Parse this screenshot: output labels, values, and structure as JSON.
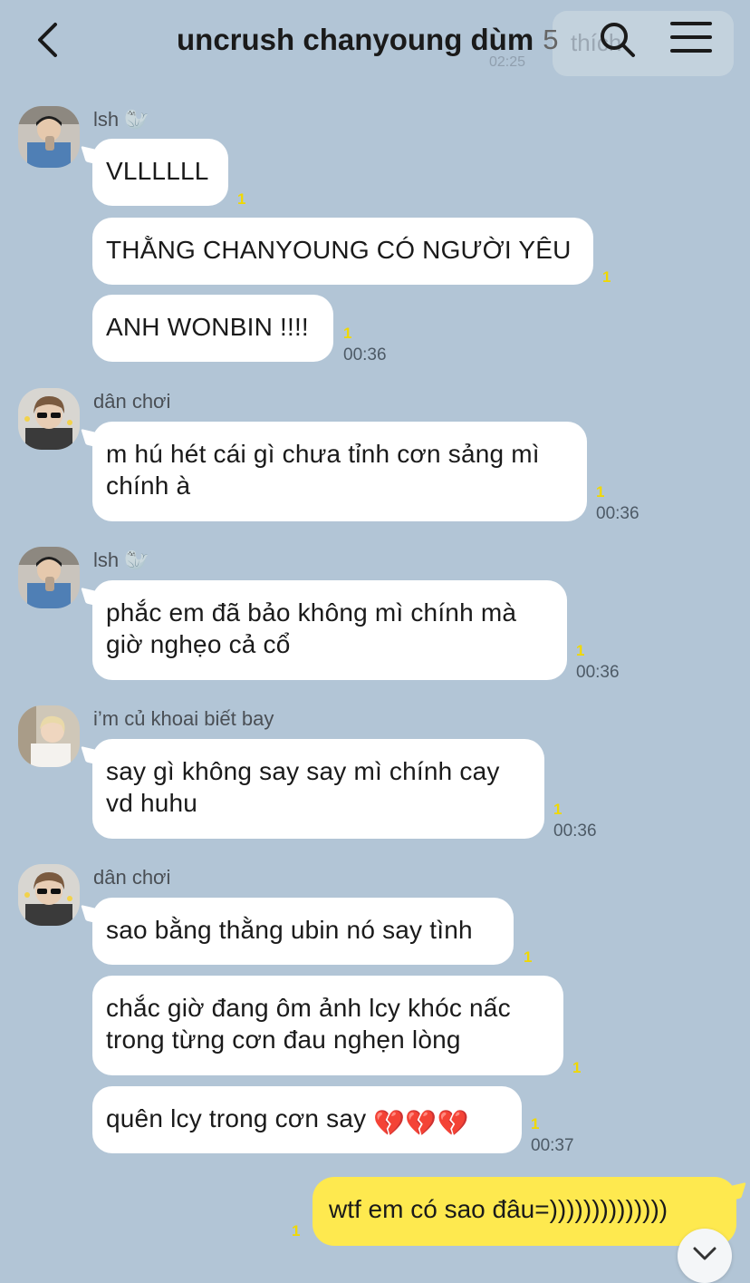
{
  "header": {
    "title": "uncrush chanyoung dùm",
    "member_count": "5",
    "ghost_text": "thích",
    "ghost_time": "02:25",
    "icons": {
      "back": "chevron-left-icon",
      "search": "search-icon",
      "menu": "menu-icon"
    }
  },
  "colors": {
    "background": "#b2c5d6",
    "my_bubble": "#fee94f",
    "unread": "#f0d800"
  },
  "messages": [
    {
      "sender": "lsh 🦭",
      "text": "VLLLLLL",
      "unread": "1",
      "time": ""
    },
    {
      "text": "THẰNG CHANYOUNG CÓ NGƯỜI YÊU",
      "unread": "1",
      "time": ""
    },
    {
      "text": "ANH WONBIN !!!!",
      "unread": "1",
      "time": "00:36"
    },
    {
      "sender": "dân chơi",
      "text": "m hú hét cái gì chưa tỉnh cơn sảng mì chính à",
      "unread": "1",
      "time": "00:36"
    },
    {
      "sender": "lsh 🦭",
      "text": "phắc em đã bảo không mì chính mà giờ nghẹo cả cổ",
      "unread": "1",
      "time": "00:36"
    },
    {
      "sender": "i’m củ khoai biết bay",
      "text": "say gì không say say mì chính cay vd huhu",
      "unread": "1",
      "time": "00:36"
    },
    {
      "sender": "dân chơi",
      "text": "sao bằng thằng ubin nó say tình",
      "unread": "1",
      "time": ""
    },
    {
      "text": "chắc giờ đang ôm ảnh lcy khóc nấc trong từng cơn đau nghẹn lòng",
      "unread": "1",
      "time": ""
    },
    {
      "text": "quên lcy trong cơn say",
      "emoji": "💔💔💔",
      "unread": "1",
      "time": "00:37"
    },
    {
      "text": "wtf em có sao đâu=))))))))))))))",
      "unread": "1",
      "mine": true
    }
  ]
}
